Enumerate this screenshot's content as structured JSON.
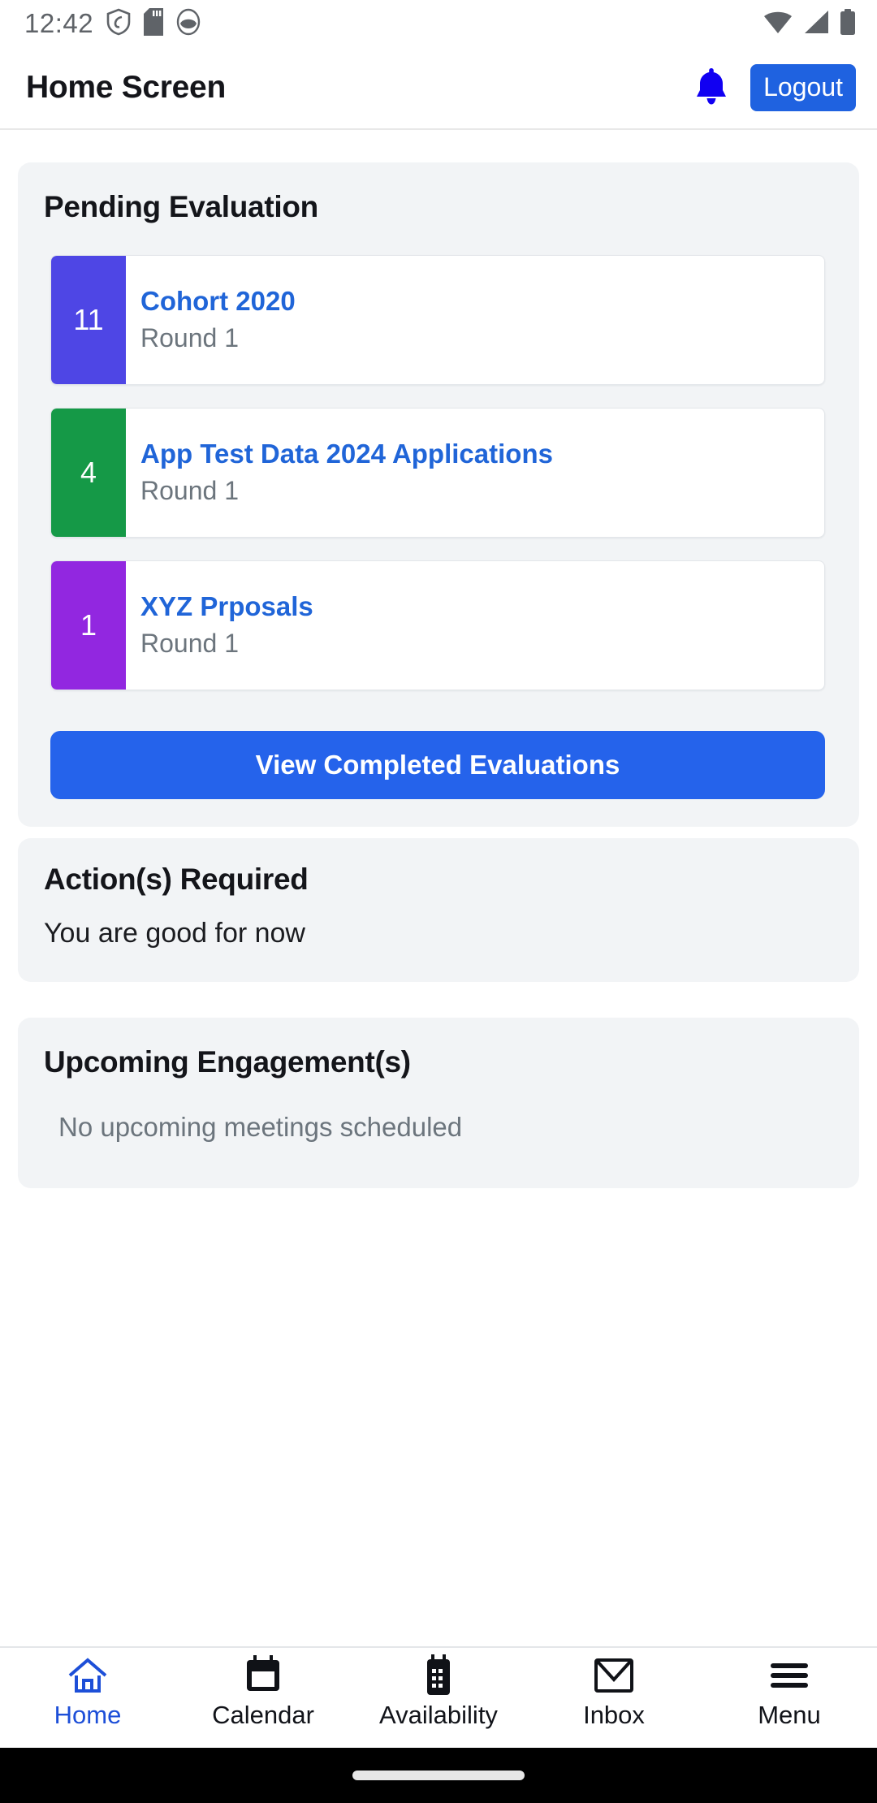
{
  "status_bar": {
    "time": "12:42",
    "left_icons": [
      "shield-icon",
      "sd-card-icon",
      "app-badge-icon"
    ],
    "right_icons": [
      "wifi-icon",
      "cellular-signal-icon",
      "battery-icon"
    ]
  },
  "header": {
    "title": "Home Screen",
    "notification_icon": "bell-icon",
    "logout_label": "Logout",
    "logout_color": "#1f62e0"
  },
  "pending": {
    "title": "Pending Evaluation",
    "items": [
      {
        "count": "11",
        "name": "Cohort 2020",
        "round": "Round 1",
        "color": "#4e46e5"
      },
      {
        "count": "4",
        "name": "App Test Data 2024 Applications",
        "round": "Round 1",
        "color": "#159947"
      },
      {
        "count": "1",
        "name": "XYZ Prposals",
        "round": "Round 1",
        "color": "#9227e0"
      }
    ],
    "view_completed_label": "View Completed Evaluations",
    "view_completed_color": "#2563eb"
  },
  "actions_required": {
    "title": "Action(s) Required",
    "message": "You are good for now"
  },
  "upcoming": {
    "title": "Upcoming Engagement(s)",
    "message": "No upcoming meetings scheduled"
  },
  "bottom_nav": {
    "active": "Home",
    "items": [
      {
        "label": "Home",
        "icon": "home-icon"
      },
      {
        "label": "Calendar",
        "icon": "calendar-icon"
      },
      {
        "label": "Availability",
        "icon": "availability-device-icon"
      },
      {
        "label": "Inbox",
        "icon": "envelope-icon"
      },
      {
        "label": "Menu",
        "icon": "hamburger-menu-icon"
      }
    ],
    "active_color": "#1d4fd8"
  }
}
